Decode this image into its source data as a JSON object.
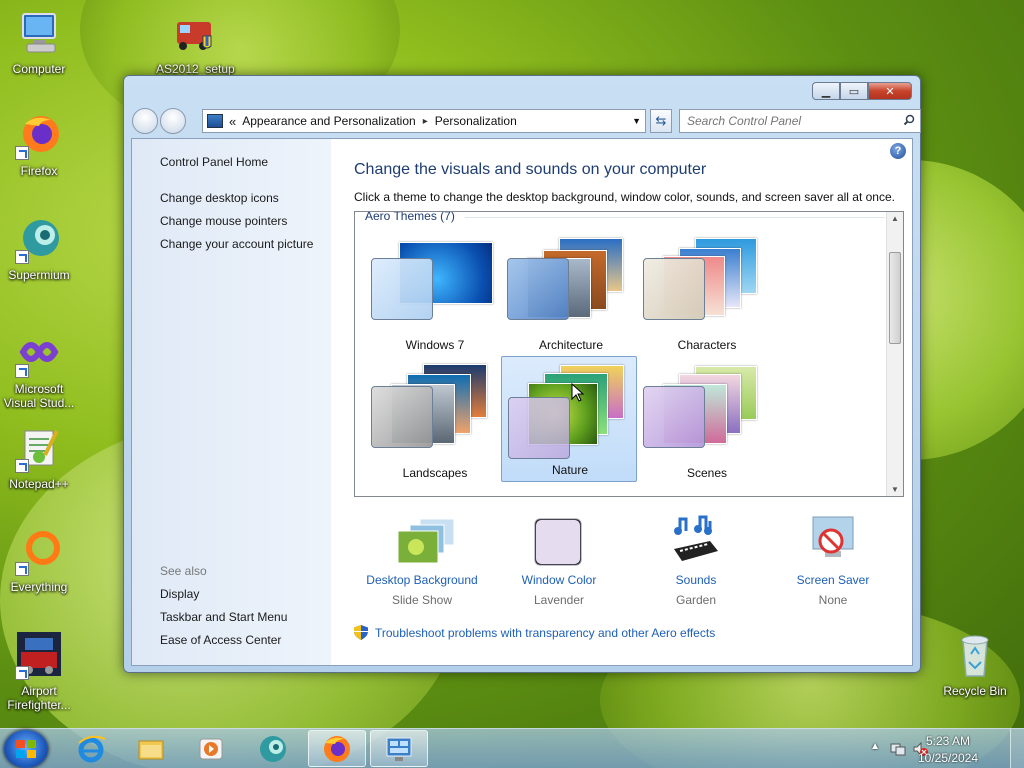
{
  "desktop": {
    "icons": [
      {
        "label": "Computer",
        "icon": "computer-icon"
      },
      {
        "label": "AS2012_setup",
        "icon": "installer-icon"
      },
      {
        "label": "Firefox",
        "icon": "firefox-icon"
      },
      {
        "label": "Supermium",
        "icon": "supermium-icon"
      },
      {
        "label": "Microsoft Visual Stud...",
        "icon": "visual-studio-icon"
      },
      {
        "label": "Notepad++",
        "icon": "notepadpp-icon"
      },
      {
        "label": "Everything",
        "icon": "everything-icon"
      },
      {
        "label": "Airport Firefighter...",
        "icon": "airport-firefighter-icon"
      },
      {
        "label": "Recycle Bin",
        "icon": "recycle-bin-icon"
      }
    ]
  },
  "window": {
    "breadcrumb": {
      "overflow": "«",
      "segment1": "Appearance and Personalization",
      "separator": "▸",
      "segment2": "Personalization"
    },
    "search_placeholder": "Search Control Panel",
    "left_pane": {
      "home": "Control Panel Home",
      "links": [
        "Change desktop icons",
        "Change mouse pointers",
        "Change your account picture"
      ],
      "see_also_heading": "See also",
      "see_also": [
        "Display",
        "Taskbar and Start Menu",
        "Ease of Access Center"
      ]
    },
    "main": {
      "title": "Change the visuals and sounds on your computer",
      "subtitle": "Click a theme to change the desktop background, window color, sounds, and screen saver all at once.",
      "group_label": "Aero Themes (7)",
      "themes": [
        {
          "name": "Windows 7",
          "selected": false
        },
        {
          "name": "Architecture",
          "selected": false
        },
        {
          "name": "Characters",
          "selected": false
        },
        {
          "name": "Landscapes",
          "selected": false
        },
        {
          "name": "Nature",
          "selected": true
        },
        {
          "name": "Scenes",
          "selected": false
        }
      ],
      "settings": [
        {
          "label": "Desktop Background",
          "value": "Slide Show",
          "icon": "desktop-background-icon"
        },
        {
          "label": "Window Color",
          "value": "Lavender",
          "icon": "window-color-icon"
        },
        {
          "label": "Sounds",
          "value": "Garden",
          "icon": "sounds-icon"
        },
        {
          "label": "Screen Saver",
          "value": "None",
          "icon": "screen-saver-icon"
        }
      ],
      "troubleshoot": "Troubleshoot problems with transparency and other Aero effects"
    }
  },
  "taskbar": {
    "time": "5:23 AM",
    "date": "10/25/2024",
    "pinned": [
      "internet-explorer-icon",
      "file-explorer-icon",
      "media-player-icon",
      "supermium-icon",
      "firefox-icon",
      "control-panel-icon"
    ]
  },
  "colors": {
    "link": "#1e5fb5",
    "title": "#1e3d72",
    "selection": "#c1dcf9"
  }
}
